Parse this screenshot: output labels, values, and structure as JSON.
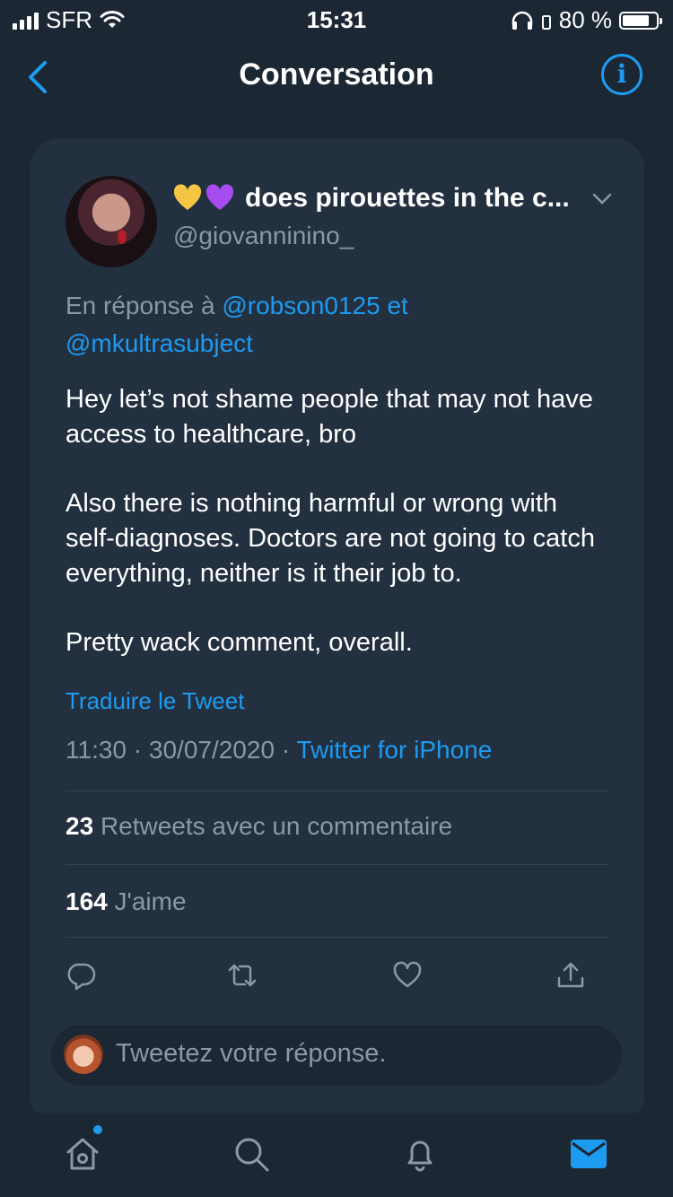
{
  "status_bar": {
    "carrier": "SFR",
    "time": "15:31",
    "battery_text": "80 %",
    "battery_level": 0.8
  },
  "nav": {
    "title": "Conversation"
  },
  "tweet": {
    "display_name": "does pirouettes in the c...",
    "name_emojis": [
      "yellow-heart",
      "purple-heart"
    ],
    "handle": "@giovanninino_",
    "reply_prefix": "En réponse à",
    "reply_user1": "@robson0125",
    "reply_joiner": "et",
    "reply_user2": "@mkultrasubject",
    "paragraphs": [
      "Hey let’s not shame people that may not have access to healthcare, bro",
      "Also there is nothing harmful or wrong with self-diagnoses. Doctors are not going to catch everything, neither is it their job to.",
      "Pretty wack comment, overall."
    ],
    "translate_label": "Traduire le Tweet",
    "time": "11:30",
    "date": "30/07/2020",
    "separator": "·",
    "source": "Twitter for iPhone",
    "retweet_count": "23",
    "retweet_label": "Retweets avec un commentaire",
    "like_count": "164",
    "like_label": "J'aime"
  },
  "reply_box": {
    "placeholder": "Tweetez votre réponse."
  },
  "colors": {
    "background": "#1c2734",
    "card": "#223040",
    "accent": "#1d9bf0",
    "muted": "#8b98a5"
  },
  "icons": [
    "back-chevron-icon",
    "info-icon",
    "chevron-down-icon",
    "reply-icon",
    "retweet-icon",
    "like-icon",
    "share-icon",
    "home-icon",
    "search-icon",
    "notifications-icon",
    "messages-icon"
  ]
}
